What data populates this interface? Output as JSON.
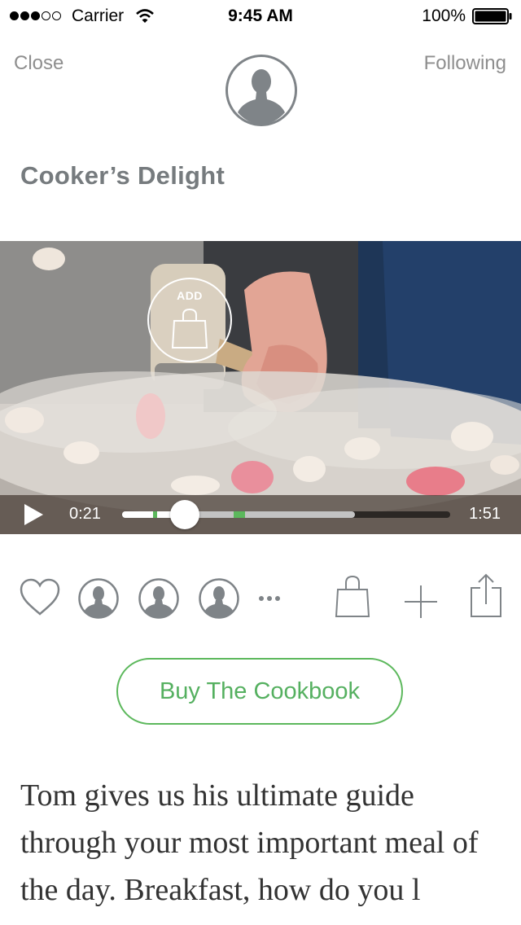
{
  "status_bar": {
    "carrier": "Carrier",
    "time": "9:45 AM",
    "battery": "100%",
    "signal_bars": 3
  },
  "nav": {
    "close_label": "Close",
    "following_label": "Following",
    "avatar_icon": "user-silhouette-icon"
  },
  "channel": {
    "title": "Cooker’s Delight"
  },
  "video": {
    "add_label": "ADD",
    "elapsed": "0:21",
    "duration": "1:51",
    "progress_fraction": 0.19,
    "buffered_fraction": 0.71
  },
  "actions": {
    "icons": [
      "heart-icon",
      "avatar-icon",
      "avatar-icon",
      "avatar-icon",
      "more-icon",
      "shopping-bag-icon",
      "plus-icon",
      "share-icon"
    ]
  },
  "buy_button": {
    "label": "Buy The Cookbook"
  },
  "description": {
    "text": "Tom gives us his ultimate guide through your most important meal of the day. Breakfast, how do you l"
  },
  "colors": {
    "accent_green": "#5cb85c",
    "title_gray": "#767b7e",
    "icon_gray": "#7f8488"
  }
}
